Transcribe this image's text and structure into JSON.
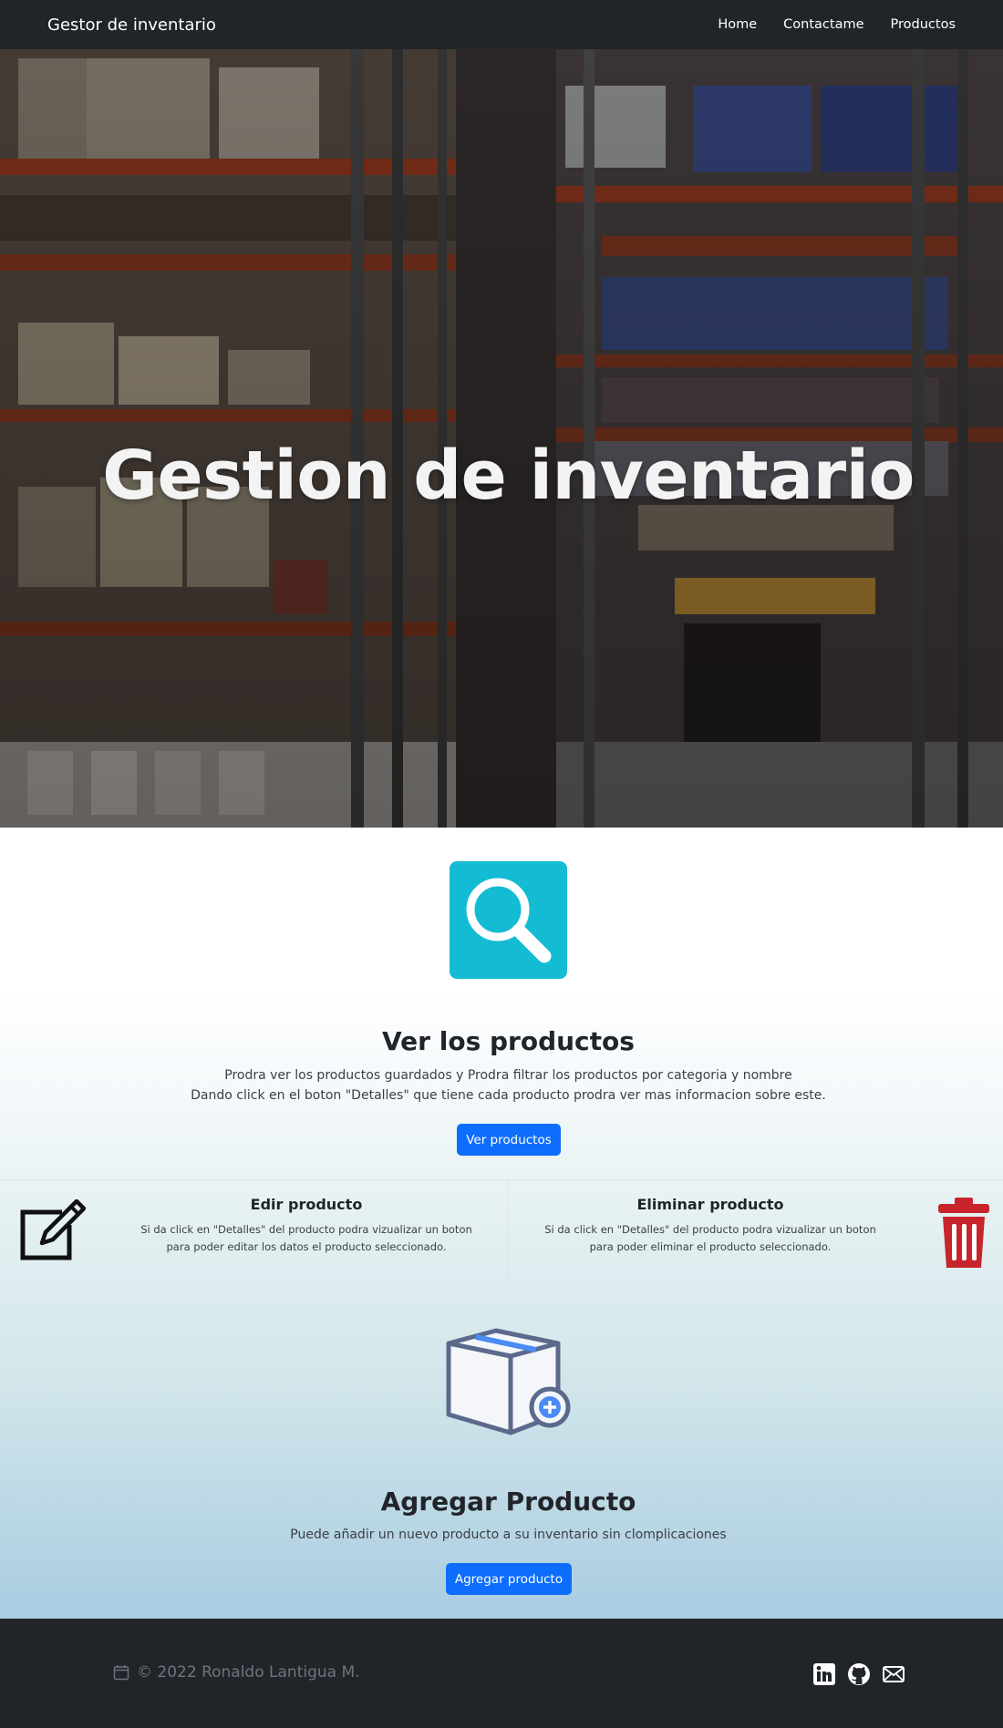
{
  "navbar": {
    "brand": "Gestor de inventario",
    "links": [
      "Home",
      "Contactame",
      "Productos"
    ]
  },
  "hero": {
    "title": "Gestion de inventario"
  },
  "view_products": {
    "title": "Ver los productos",
    "line1": "Prodra ver los productos guardados y Prodra filtrar los productos por categoria y nombre",
    "line2": "Dando click en el boton \"Detalles\" que tiene cada producto prodra ver mas informacion sobre este.",
    "button": "Ver productos"
  },
  "edit_product": {
    "title": "Edir producto",
    "text": "Si da click en \"Detalles\" del producto podra vizualizar un boton para poder editar los datos el producto seleccionado."
  },
  "delete_product": {
    "title": "Eliminar producto",
    "text": "Si da click en \"Detalles\" del producto podra vizualizar un boton para poder eliminar el producto seleccionado."
  },
  "add_product": {
    "title": "Agregar Producto",
    "text": "Puede añadir un nuevo producto a su inventario sin clomplicaciones",
    "button": "Agregar producto"
  },
  "footer": {
    "copyright": "© 2022 Ronaldo Lantigua M.",
    "icons": [
      "calendar-icon",
      "linkedin-icon",
      "github-icon",
      "mail-icon"
    ]
  },
  "colors": {
    "navbar": "#212529",
    "primary_button": "#0d6efd",
    "search_tile": "#13bcd3",
    "trash": "#c8242b"
  }
}
